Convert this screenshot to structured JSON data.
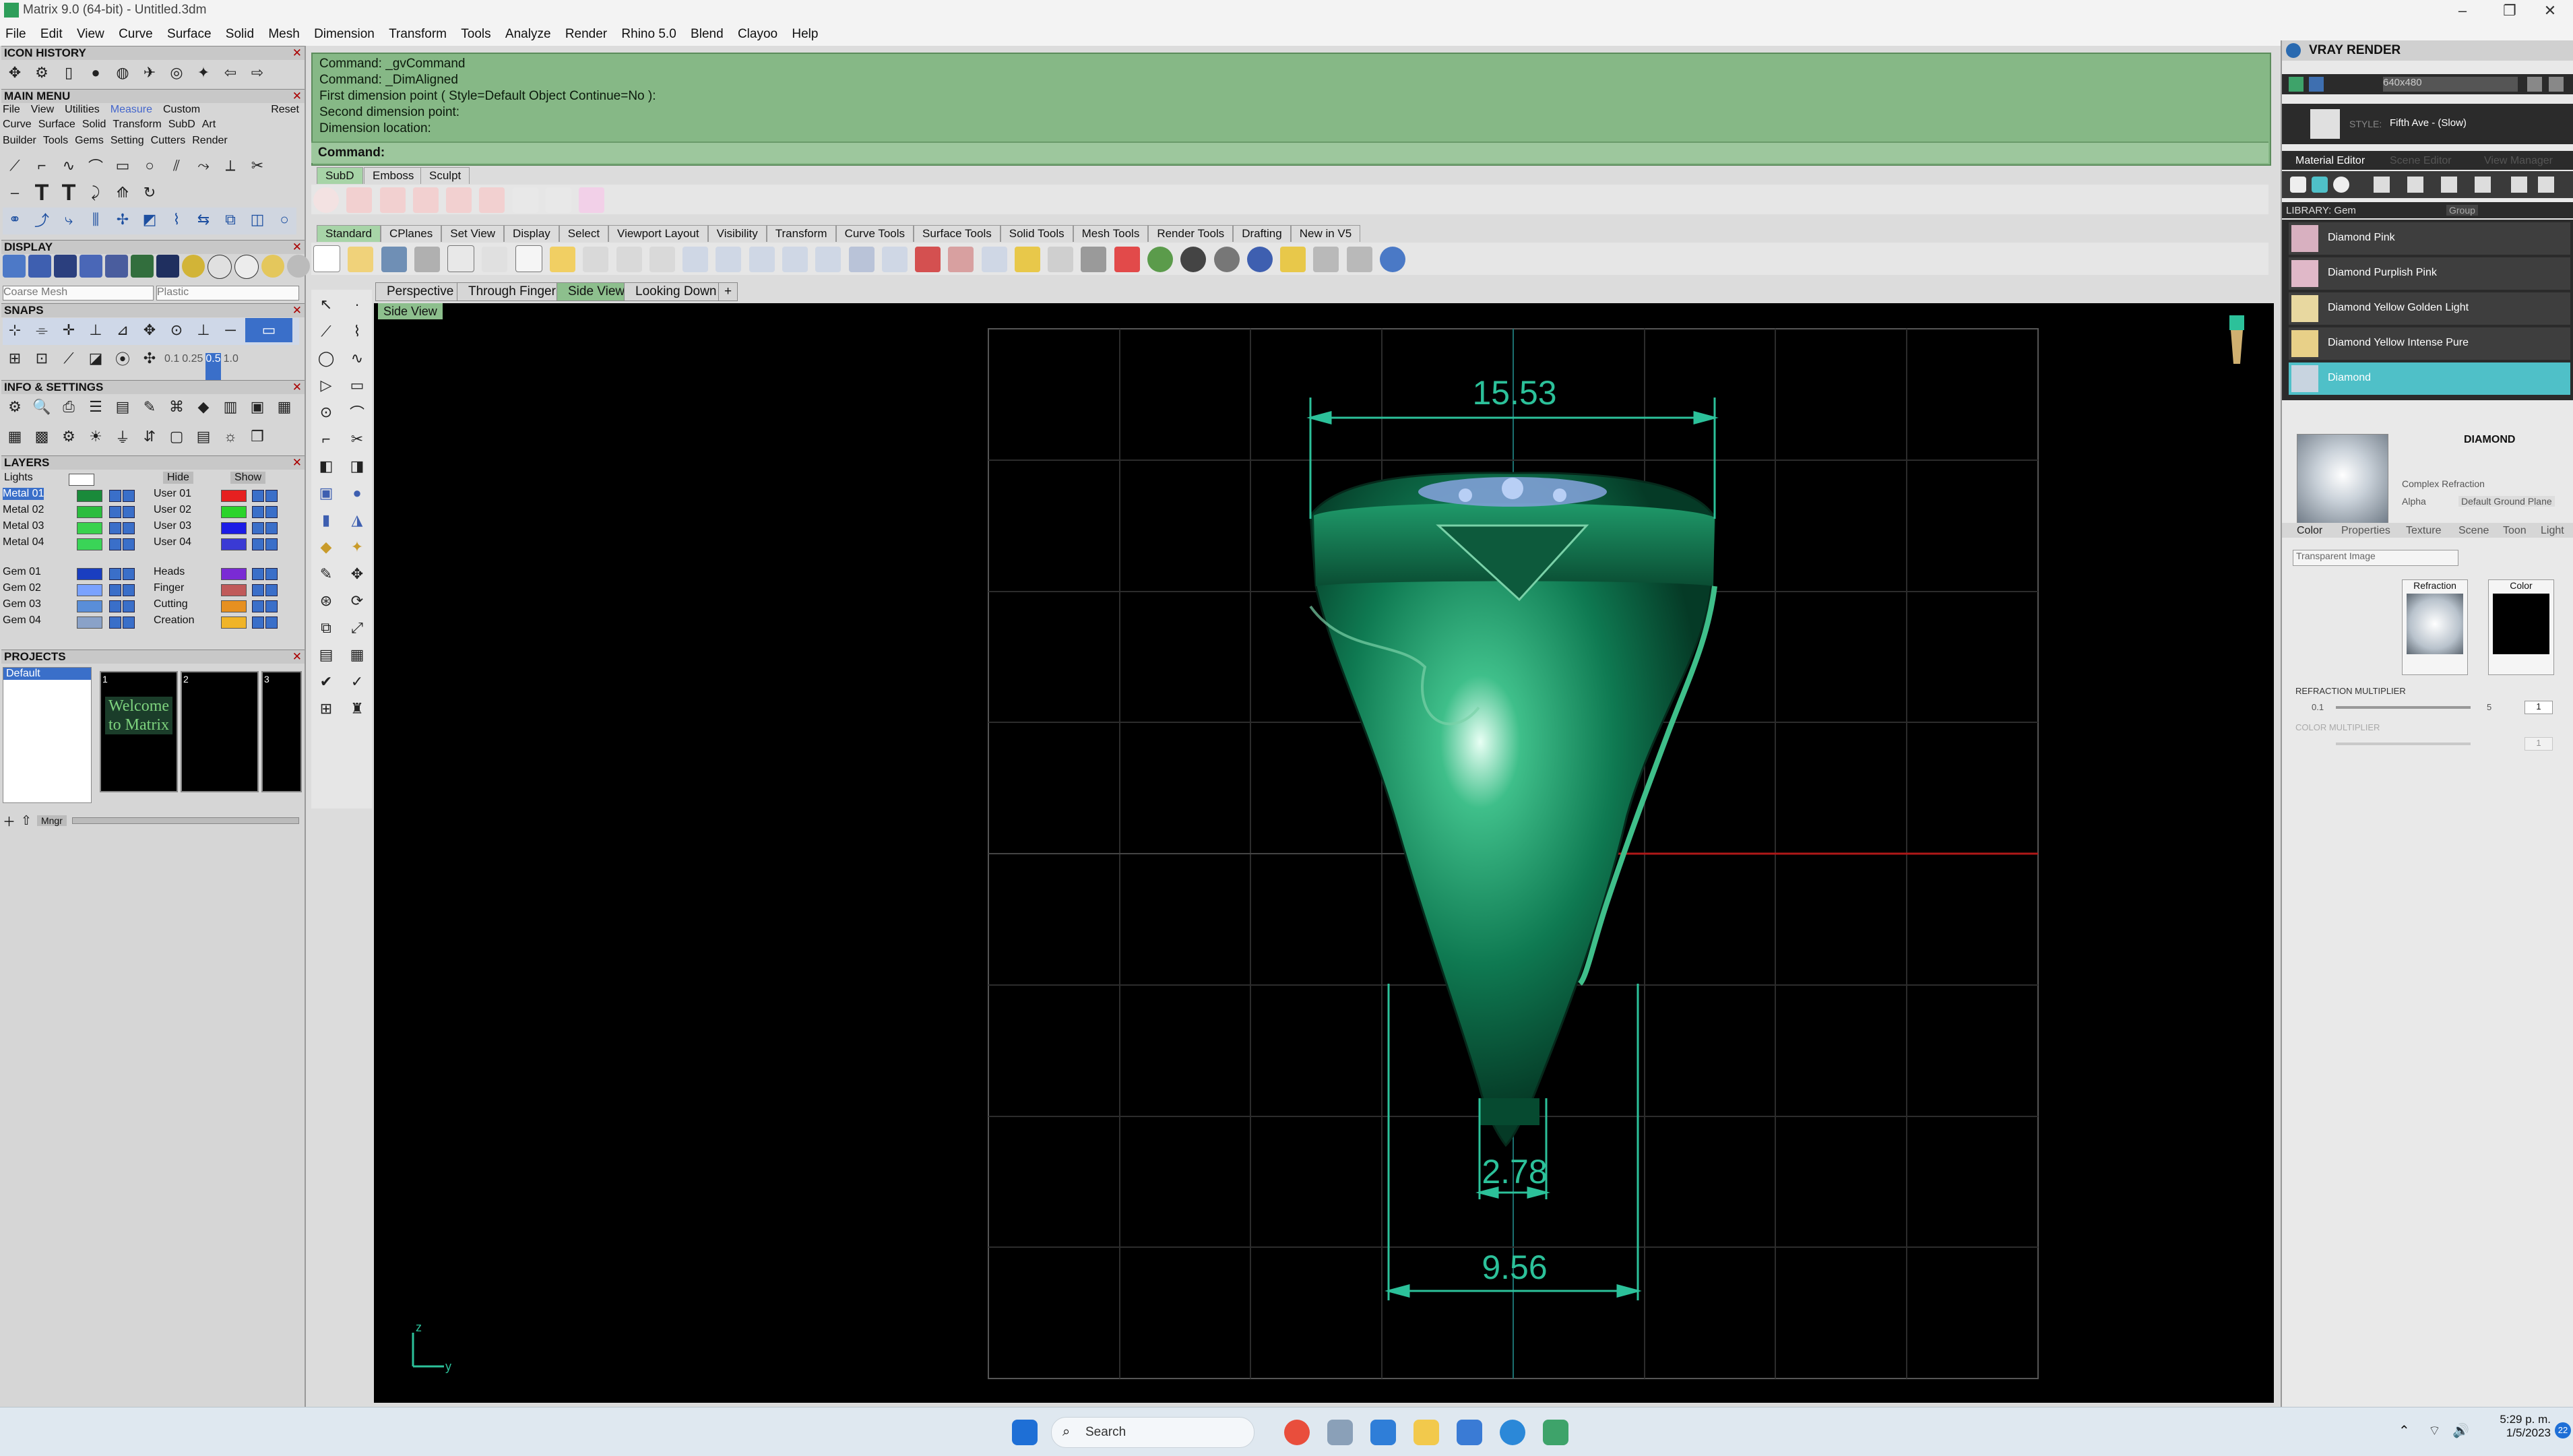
{
  "window": {
    "title": "Matrix 9.0 (64-bit) - Untitled.3dm"
  },
  "menu": [
    "File",
    "Edit",
    "View",
    "Curve",
    "Surface",
    "Solid",
    "Mesh",
    "Dimension",
    "Transform",
    "Tools",
    "Analyze",
    "Render",
    "Rhino 5.0",
    "Blend",
    "Clayoo",
    "Help"
  ],
  "left": {
    "icon_history": "ICON HISTORY",
    "main_menu": "MAIN MENU",
    "main_menu_tabs": [
      "File",
      "View",
      "Utilities",
      "Measure",
      "Custom",
      "Reset"
    ],
    "main_menu_row1": [
      "Curve",
      "Surface",
      "Solid",
      "Transform",
      "SubD",
      "Art"
    ],
    "main_menu_row2": [
      "Builder",
      "Tools",
      "Gems",
      "Setting",
      "Cutters",
      "Render"
    ],
    "display": "DISPLAY",
    "display_mode": "Coarse Mesh",
    "display_material": "Plastic",
    "snaps": "SNAPS",
    "snap_values": [
      "0.1",
      "0.25",
      "0.5",
      "1.0"
    ],
    "info": "INFO & SETTINGS",
    "layers": "LAYERS",
    "layers_header": {
      "lights": "Lights",
      "hide": "Hide",
      "show": "Show"
    },
    "layers_left": [
      "Metal 01",
      "Metal 02",
      "Metal 03",
      "Metal 04",
      "Gem 01",
      "Gem 02",
      "Gem 03",
      "Gem 04"
    ],
    "layers_right": [
      "User 01",
      "User 02",
      "User 03",
      "User 04",
      "Heads",
      "Finger",
      "Cutting",
      "Creation"
    ],
    "projects": "PROJECTS",
    "project_default": "Default",
    "project_thumb": "Welcome to Matrix",
    "project_nums": [
      "1",
      "2",
      "3"
    ],
    "project_mngr": "Mngr"
  },
  "command": {
    "lines": [
      "Command: _gvCommand",
      "Command: _DimAligned",
      "First dimension point ( Style=Default  Object  Continue=No ):",
      "Second dimension point:",
      "Dimension location:"
    ],
    "prompt": "Command:"
  },
  "tabs_top": [
    "SubD",
    "Emboss",
    "Sculpt"
  ],
  "toolbar_tabs": [
    "Standard",
    "CPlanes",
    "Set View",
    "Display",
    "Select",
    "Viewport Layout",
    "Visibility",
    "Transform",
    "Curve Tools",
    "Surface Tools",
    "Solid Tools",
    "Mesh Tools",
    "Render Tools",
    "Drafting",
    "New in V5"
  ],
  "viewport_tabs": [
    "Perspective",
    "Through Finger",
    "Side View",
    "Looking Down"
  ],
  "viewport": {
    "label": "Side View",
    "dim_top": "15.53",
    "dim_mid": "2.78",
    "dim_bottom": "9.56",
    "axis_z": "z",
    "axis_y": "y"
  },
  "right": {
    "title": "VRAY RENDER",
    "resolution": "640x480",
    "style_label": "STYLE:",
    "style_value": "Fifth Ave - (Slow)",
    "tabs": [
      "Material Editor",
      "Scene Editor",
      "View Manager"
    ],
    "library_label": "LIBRARY: Gem",
    "group_label": "Group",
    "materials": [
      "Diamond Pink",
      "Diamond Purplish Pink",
      "Diamond Yellow Golden Light",
      "Diamond Yellow Intense Pure",
      "Diamond"
    ],
    "selected_name": "DIAMOND",
    "complex": "Complex Refraction",
    "alpha": "Alpha",
    "ground": "Default Ground Plane",
    "subtabs": [
      "Color",
      "Properties",
      "Texture",
      "Scene",
      "Toon",
      "Light"
    ],
    "transparency": "Transparent Image",
    "refraction_label": "Refraction",
    "color_label": "Color",
    "refraction_mult": "REFRACTION MULTIPLIER",
    "color_mult": "COLOR MULTIPLIER",
    "slider_min": "0.1",
    "slider_max": "5",
    "slider_val": "1"
  },
  "taskbar": {
    "search": "Search",
    "time": "5:29 p. m.",
    "date": "1/5/2023",
    "badge": "22"
  }
}
